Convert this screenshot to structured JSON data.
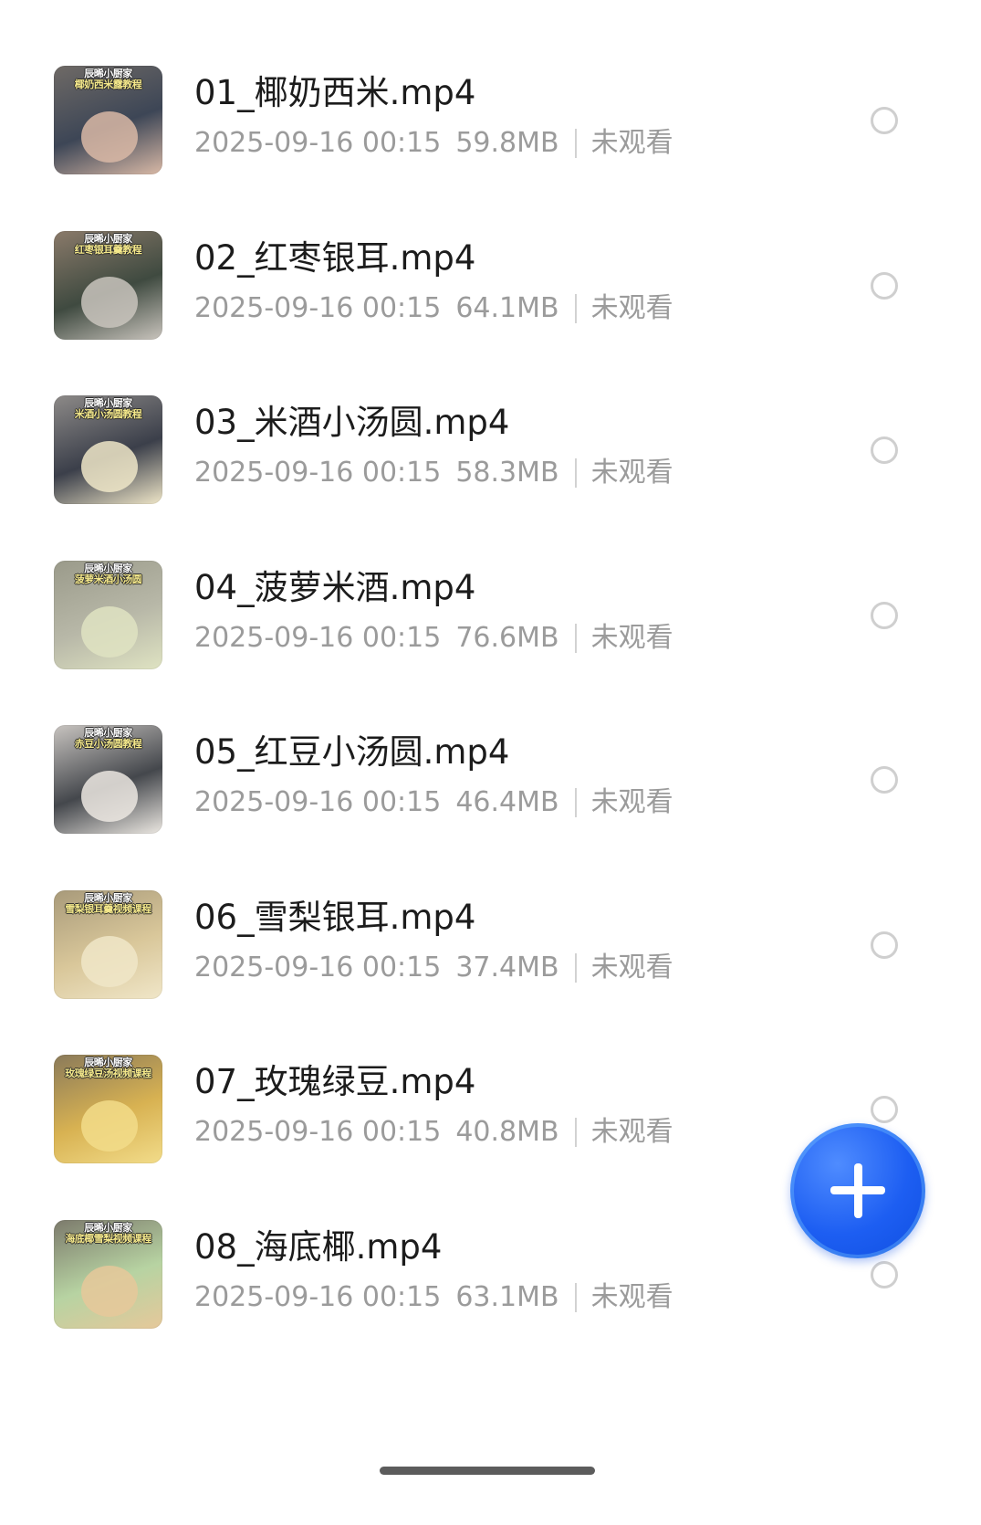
{
  "files": [
    {
      "name": "01_椰奶西米.mp4",
      "date": "2025-09-16 00:15",
      "size": "59.8MB",
      "status": "未观看",
      "thumb_line1": "辰晞小厨家",
      "thumb_line2": "椰奶西米露教程",
      "thumb_colors": [
        "#6f6a66",
        "#3d4656",
        "#d9b9a6"
      ]
    },
    {
      "name": "02_红枣银耳.mp4",
      "date": "2025-09-16 00:15",
      "size": "64.1MB",
      "status": "未观看",
      "thumb_line1": "辰晞小厨家",
      "thumb_line2": "红枣银耳羹教程",
      "thumb_colors": [
        "#8a7a6a",
        "#3f4a40",
        "#c9c4bd"
      ]
    },
    {
      "name": "03_米酒小汤圆.mp4",
      "date": "2025-09-16 00:15",
      "size": "58.3MB",
      "status": "未观看",
      "thumb_line1": "辰晞小厨家",
      "thumb_line2": "米酒小汤圆教程",
      "thumb_colors": [
        "#8d8a88",
        "#3b3f4a",
        "#efe6c8"
      ]
    },
    {
      "name": "04_菠萝米酒.mp4",
      "date": "2025-09-16 00:15",
      "size": "76.6MB",
      "status": "未观看",
      "thumb_line1": "辰晞小厨家",
      "thumb_line2": "菠萝米酒小汤圆",
      "thumb_colors": [
        "#9a9a8a",
        "#b8b8a8",
        "#dfe3c2"
      ]
    },
    {
      "name": "05_红豆小汤圆.mp4",
      "date": "2025-09-16 00:15",
      "size": "46.4MB",
      "status": "未观看",
      "thumb_line1": "辰晞小厨家",
      "thumb_line2": "赤豆小汤圆教程",
      "thumb_colors": [
        "#c8c4c0",
        "#44474c",
        "#ece8e2"
      ]
    },
    {
      "name": "06_雪梨银耳.mp4",
      "date": "2025-09-16 00:15",
      "size": "37.4MB",
      "status": "未观看",
      "thumb_line1": "辰晞小厨家",
      "thumb_line2": "雪梨银耳羹视频课程",
      "thumb_colors": [
        "#a89a7a",
        "#d9c79a",
        "#f0e6c8"
      ]
    },
    {
      "name": "07_玫瑰绿豆.mp4",
      "date": "2025-09-16 00:15",
      "size": "40.8MB",
      "status": "未观看",
      "thumb_line1": "辰晞小厨家",
      "thumb_line2": "玫瑰绿豆汤视频课程",
      "thumb_colors": [
        "#8a7a5a",
        "#d8b252",
        "#f2dc8a"
      ]
    },
    {
      "name": "08_海底椰.mp4",
      "date": "2025-09-16 00:15",
      "size": "63.1MB",
      "status": "未观看",
      "thumb_line1": "辰晞小厨家",
      "thumb_line2": "海底椰雪梨视频课程",
      "thumb_colors": [
        "#7c7a6c",
        "#b7d3a2",
        "#e6c89a"
      ]
    }
  ],
  "fab": {
    "icon": "plus-icon",
    "color": "#1d5ef2"
  },
  "colors": {
    "title": "#1c1c1c",
    "meta": "#9b9b9b",
    "radio_border": "#cfcfcf",
    "background": "#ffffff"
  }
}
